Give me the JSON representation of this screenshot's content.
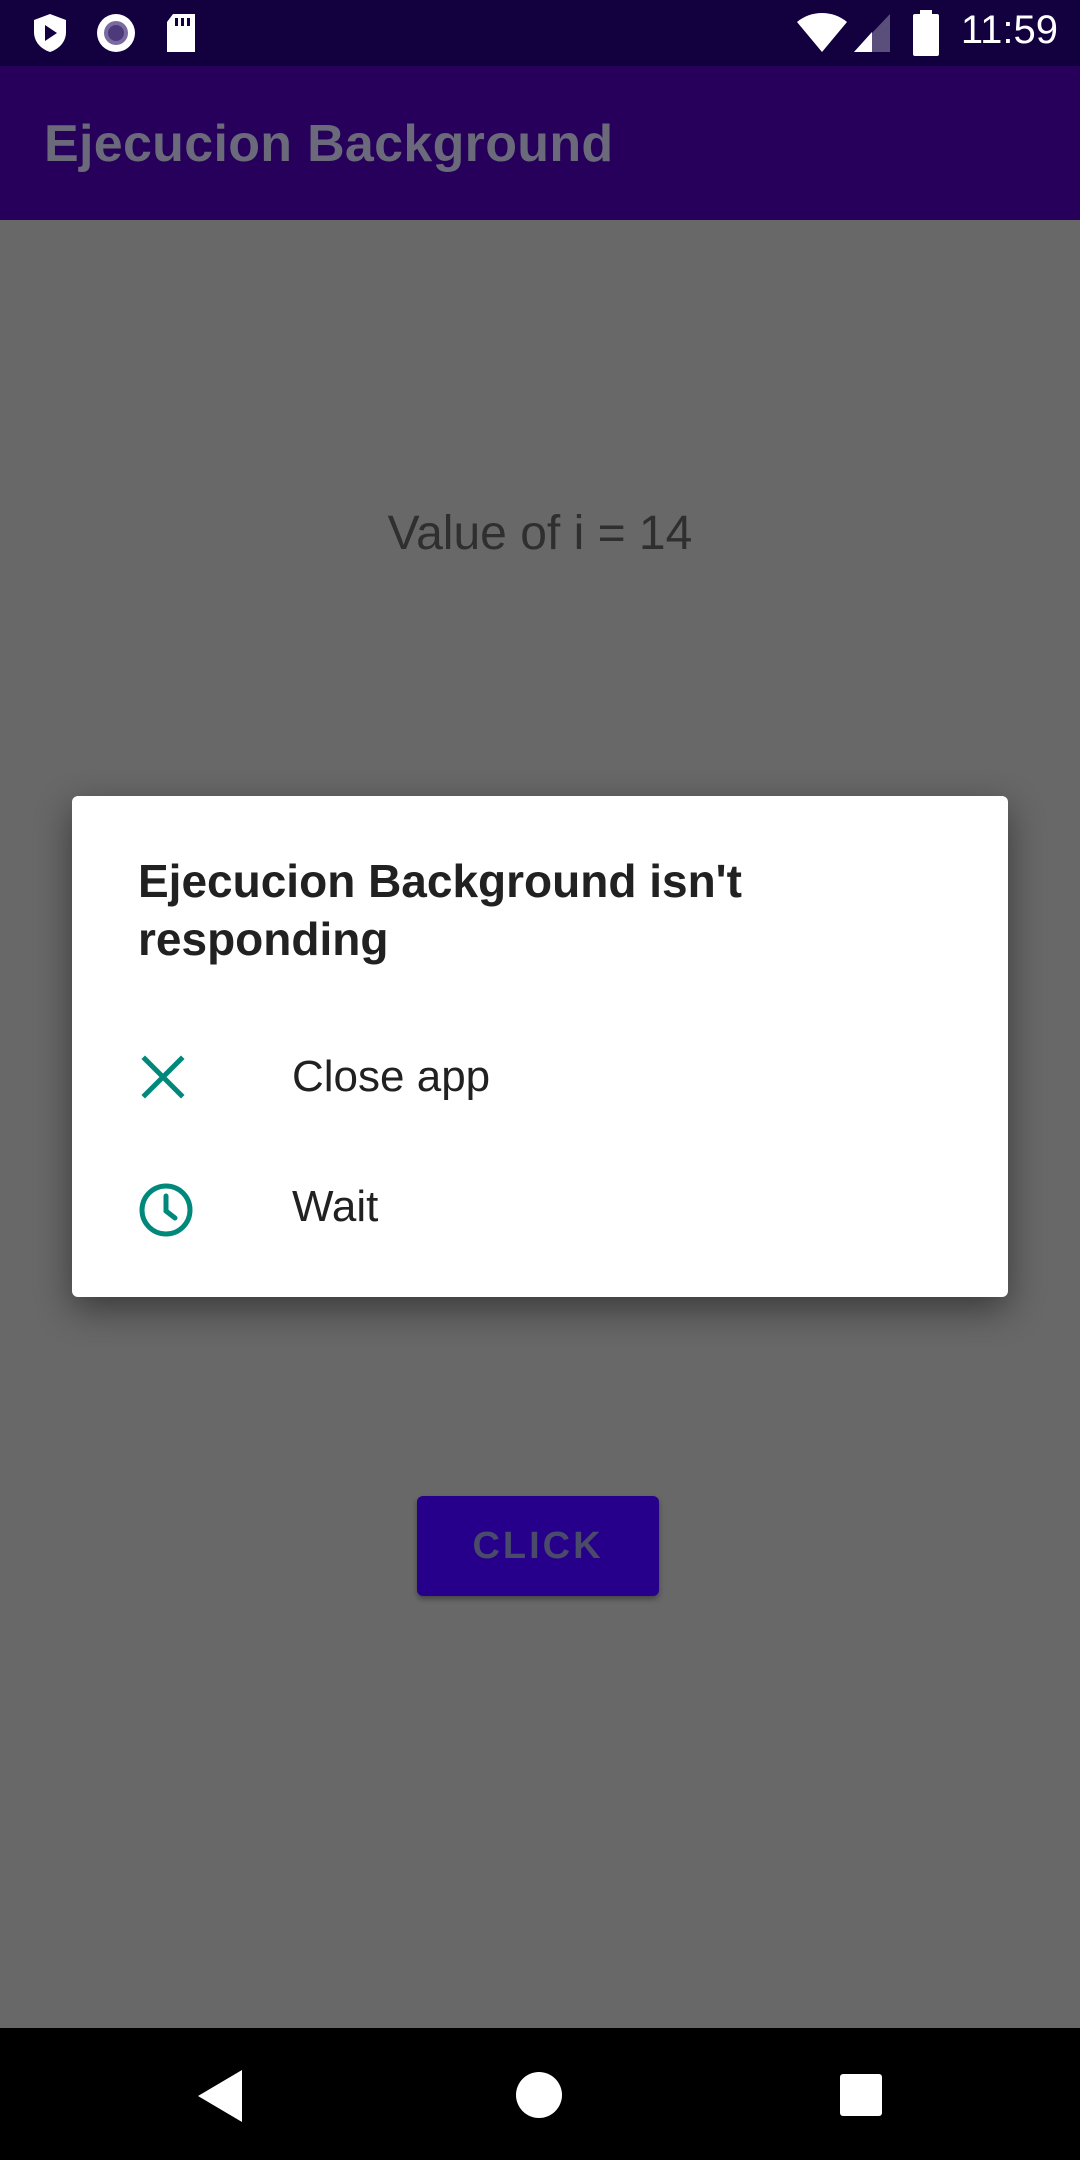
{
  "status_bar": {
    "time": "11:59",
    "left_icons": [
      "shield-play-icon",
      "record-icon",
      "sd-card-icon"
    ],
    "right_icons": [
      "wifi-icon",
      "cell-signal-icon",
      "battery-icon"
    ]
  },
  "app_bar": {
    "title": "Ejecucion Background"
  },
  "main": {
    "value_text": "Value of i = 14",
    "button_label": "CLICK"
  },
  "dialog": {
    "title": "Ejecucion Background isn't responding",
    "options": [
      {
        "label": "Close app",
        "icon": "close-icon"
      },
      {
        "label": "Wait",
        "icon": "clock-icon"
      }
    ]
  },
  "nav_bar": {
    "buttons": [
      "back-icon",
      "home-icon",
      "recents-icon"
    ]
  },
  "colors": {
    "status_bar": "#12003f",
    "app_bar": "#26005b",
    "scrim_content": "#686868",
    "button": "#26008a",
    "dialog_icon": "#00897b"
  }
}
